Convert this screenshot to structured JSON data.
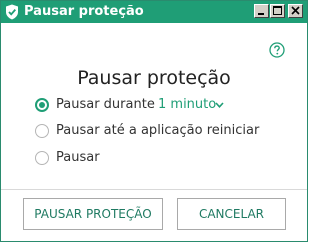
{
  "window": {
    "title": "Pausar proteção",
    "accent_color": "#1f9e76",
    "controls": [
      "minimize-icon",
      "maximize-icon",
      "close-icon"
    ]
  },
  "help": {
    "icon": "help-icon"
  },
  "heading": "Pausar proteção",
  "options": [
    {
      "label": "Pausar durante",
      "selected": true
    },
    {
      "label": "Pausar até a aplicação reiniciar",
      "selected": false
    },
    {
      "label": "Pausar",
      "selected": false
    }
  ],
  "duration": {
    "value": "1 minuto",
    "icon": "chevron-down-icon"
  },
  "buttons": {
    "confirm": "PAUSAR PROTEÇÃO",
    "cancel": "CANCELAR"
  }
}
